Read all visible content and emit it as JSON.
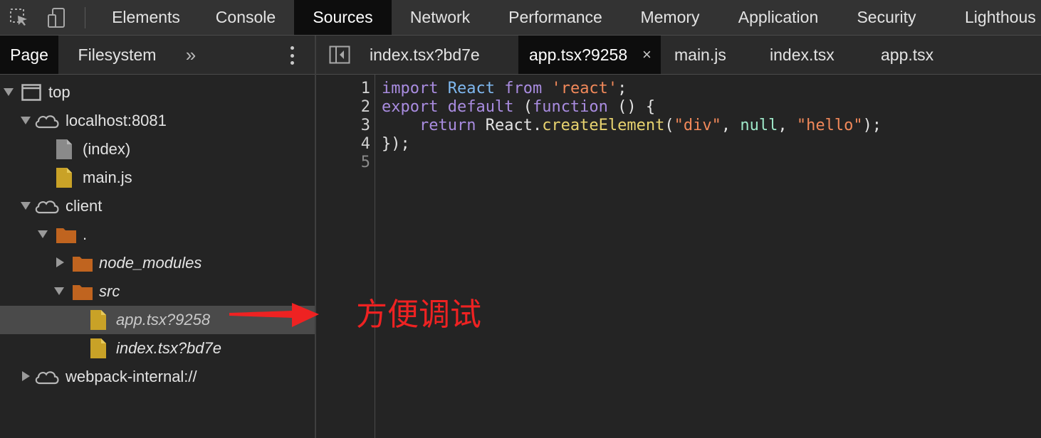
{
  "toolbar": {
    "inspect_icon": "element-picker-icon",
    "device_icon": "device-toggle-icon"
  },
  "top_tabs": [
    {
      "label": "Elements",
      "active": false
    },
    {
      "label": "Console",
      "active": false
    },
    {
      "label": "Sources",
      "active": true
    },
    {
      "label": "Network",
      "active": false
    },
    {
      "label": "Performance",
      "active": false
    },
    {
      "label": "Memory",
      "active": false
    },
    {
      "label": "Application",
      "active": false
    },
    {
      "label": "Security",
      "active": false
    },
    {
      "label": "Lighthous",
      "active": false
    }
  ],
  "navigator": {
    "tabs": [
      {
        "label": "Page",
        "active": true
      },
      {
        "label": "Filesystem",
        "active": false
      }
    ],
    "more": "»",
    "tree": [
      {
        "label": "top",
        "icon": "frame-icon",
        "expanded": true
      },
      {
        "label": "localhost:8081",
        "icon": "cloud-icon",
        "expanded": true
      },
      {
        "label": "(index)",
        "icon": "document-icon"
      },
      {
        "label": "main.js",
        "icon": "script-file-icon"
      },
      {
        "label": "client",
        "icon": "cloud-icon",
        "expanded": true
      },
      {
        "label": ".",
        "icon": "folder-icon",
        "expanded": true
      },
      {
        "label": "node_modules",
        "icon": "folder-icon",
        "expanded": false
      },
      {
        "label": "src",
        "icon": "folder-icon",
        "expanded": true
      },
      {
        "label": "app.tsx?9258",
        "icon": "script-file-icon",
        "selected": true
      },
      {
        "label": "index.tsx?bd7e",
        "icon": "script-file-icon"
      },
      {
        "label": "webpack-internal://",
        "icon": "cloud-icon",
        "expanded": false
      }
    ]
  },
  "editor": {
    "toggle_icon": "toggle-navigator-icon",
    "file_tabs": [
      {
        "label": "index.tsx?bd7e",
        "active": false
      },
      {
        "label": "app.tsx?9258",
        "active": true,
        "close": "×"
      },
      {
        "label": "main.js",
        "active": false
      },
      {
        "label": "index.tsx",
        "active": false
      },
      {
        "label": "app.tsx",
        "active": false
      }
    ],
    "line_numbers": [
      "1",
      "2",
      "3",
      "4",
      "5"
    ],
    "code": {
      "l1": [
        "import",
        " ",
        "React",
        " ",
        "from",
        " ",
        "'react'",
        ";"
      ],
      "l2": [
        "export",
        " ",
        "default",
        " (",
        "function",
        " () {"
      ],
      "l3": [
        "    ",
        "return",
        " React.",
        "createElement",
        "(",
        "\"div\"",
        ", ",
        "null",
        ", ",
        "\"hello\"",
        ");"
      ],
      "l4": [
        "});"
      ]
    }
  },
  "annotation": {
    "text": "方便调试",
    "color": "#ee2222",
    "arrow_icon": "red-arrow-icon"
  },
  "colors": {
    "keyword": "#c792ea",
    "identifier": "#7fb8f0",
    "string": "#f2895a",
    "function": "#e8d36f",
    "null": "#9ee8c8"
  }
}
